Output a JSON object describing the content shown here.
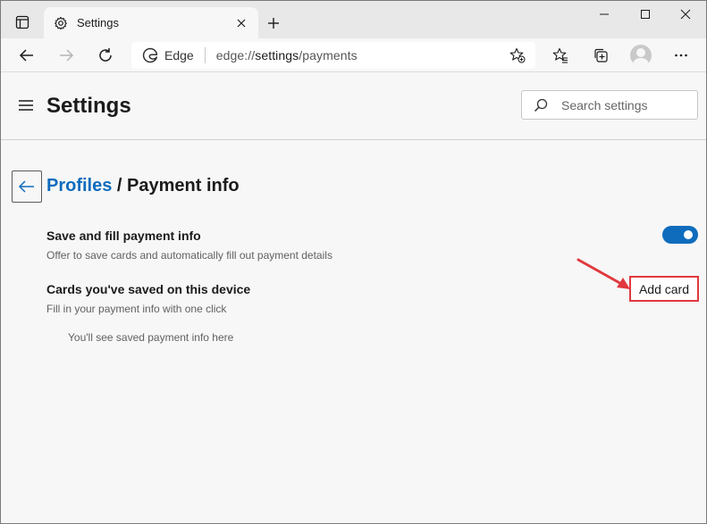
{
  "browser": {
    "tab_title": "Settings",
    "site_label": "Edge",
    "url_prefix": "edge://",
    "url_host": "settings",
    "url_path": "/payments"
  },
  "header": {
    "title": "Settings",
    "search_placeholder": "Search settings"
  },
  "breadcrumb": {
    "parent": "Profiles",
    "separator": " / ",
    "current": "Payment info"
  },
  "settings": {
    "save_fill": {
      "title": "Save and fill payment info",
      "description": "Offer to save cards and automatically fill out payment details",
      "enabled": true
    },
    "saved_cards": {
      "title": "Cards you've saved on this device",
      "description": "Fill in your payment info with one click",
      "add_button": "Add card",
      "empty_message": "You'll see saved payment info here"
    }
  },
  "colors": {
    "accent": "#0f6cbd",
    "annotation": "#e0393e"
  }
}
